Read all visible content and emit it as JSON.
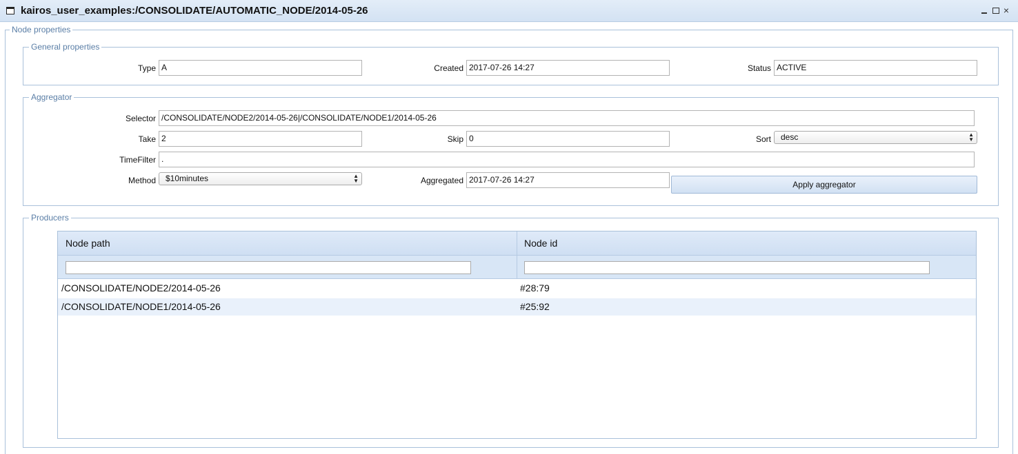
{
  "window": {
    "title": "kairos_user_examples:/CONSOLIDATE/AUTOMATIC_NODE/2014-05-26",
    "controls": {
      "minimize": "",
      "maximize": "",
      "close": "×"
    }
  },
  "node_properties": {
    "legend": "Node properties",
    "general": {
      "legend": "General properties",
      "type_label": "Type",
      "type_value": "A",
      "created_label": "Created",
      "created_value": "2017-07-26 14:27",
      "status_label": "Status",
      "status_value": "ACTIVE"
    },
    "aggregator": {
      "legend": "Aggregator",
      "selector_label": "Selector",
      "selector_value": "/CONSOLIDATE/NODE2/2014-05-26|/CONSOLIDATE/NODE1/2014-05-26",
      "take_label": "Take",
      "take_value": "2",
      "skip_label": "Skip",
      "skip_value": "0",
      "sort_label": "Sort",
      "sort_value": "desc",
      "timefilter_label": "TimeFilter",
      "timefilter_value": ".",
      "method_label": "Method",
      "method_value": "$10minutes",
      "aggregated_label": "Aggregated",
      "aggregated_value": "2017-07-26 14:27",
      "apply_button": "Apply aggregator"
    },
    "producers": {
      "legend": "Producers",
      "columns": [
        "Node path",
        "Node id"
      ],
      "rows": [
        {
          "path": "/CONSOLIDATE/NODE2/2014-05-26",
          "id": "#28:79"
        },
        {
          "path": "/CONSOLIDATE/NODE1/2014-05-26",
          "id": "#25:92"
        }
      ]
    }
  }
}
